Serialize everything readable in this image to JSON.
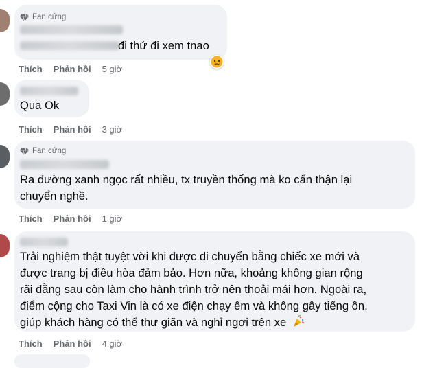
{
  "badge_label": "Fan cứng",
  "like_label": "Thích",
  "reply_label": "Phản hồi",
  "comments": [
    {
      "text": "đi thử đi xem tnao",
      "time": "5 giờ"
    },
    {
      "text": "Qua Ok",
      "time": "3 giờ"
    },
    {
      "text": "Ra đường xanh ngọc rất nhiều, tx truyền thống mà ko cẩn thận lại",
      "text2": "chuyển nghề.",
      "time": "1 giờ"
    },
    {
      "lines": [
        "Trải nghiệm thật tuyệt vời khi được di chuyển bằng chiếc xe mới và",
        "được trang bị điều hòa đảm bảo. Hơn nữa, khoảng không gian rộng",
        "rãi đằng sau còn làm cho hành trình trở nên thoải mái hơn. Ngoài ra,",
        "điểm cộng cho Taxi Vin là có xe điện chạy êm và không gây tiếng ồn,",
        "giúp khách hàng có thể thư giãn và nghỉ ngơi trên xe"
      ],
      "time": "4 giờ"
    }
  ],
  "icons": {
    "badge": "diamond-icon",
    "reaction": "sad-face-icon",
    "emoji": "party-popper-icon"
  },
  "colors": {
    "bubble": "#f0f2f5",
    "meta": "#65676b",
    "text": "#050505"
  }
}
